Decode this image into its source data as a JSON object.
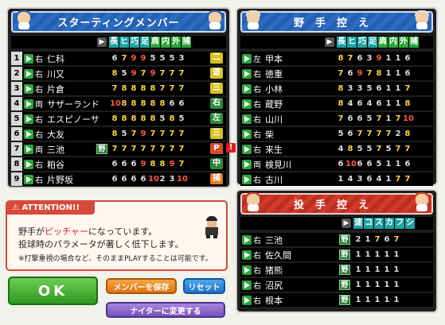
{
  "starting": {
    "title": "スターティングメンバー",
    "columns": [
      "長",
      "ヒ",
      "巧",
      "足",
      "肩",
      "内",
      "外",
      "捕"
    ],
    "rows": [
      {
        "num": "1",
        "hand": "右",
        "name": "仁科",
        "stats": [
          "6",
          "7",
          "9",
          "9",
          "5",
          "5",
          "5",
          "3"
        ],
        "pos": "二",
        "poscolor": "#d7c21b"
      },
      {
        "num": "2",
        "hand": "右",
        "name": "川又",
        "stats": [
          "8",
          "5",
          "9",
          "7",
          "9",
          "7",
          "7",
          "7"
        ],
        "pos": "遊",
        "poscolor": "#d7c21b"
      },
      {
        "num": "3",
        "hand": "右",
        "name": "片倉",
        "stats": [
          "7",
          "8",
          "8",
          "8",
          "8",
          "7",
          "7",
          "7"
        ],
        "pos": "三",
        "poscolor": "#d7c21b"
      },
      {
        "num": "4",
        "hand": "両",
        "name": "サザーランド",
        "stats": [
          "10",
          "8",
          "8",
          "8",
          "8",
          "8",
          "6",
          "6"
        ],
        "pos": "右",
        "poscolor": "#2b8b3a"
      },
      {
        "num": "5",
        "hand": "右",
        "name": "エスピノーサ",
        "stats": [
          "8",
          "8",
          "8",
          "8",
          "8",
          "5",
          "8",
          "5"
        ],
        "pos": "左",
        "poscolor": "#2b8b3a"
      },
      {
        "num": "6",
        "hand": "右",
        "name": "大友",
        "stats": [
          "8",
          "5",
          "7",
          "9",
          "7",
          "7",
          "7",
          "7"
        ],
        "pos": "三",
        "poscolor": "#d7c21b"
      },
      {
        "num": "7",
        "hand": "両",
        "name": "三池",
        "tag": "野",
        "stats": [
          "7",
          "7",
          "7",
          "7",
          "7",
          "7",
          "7",
          "7"
        ],
        "pos": "P",
        "poscolor": "#d64b2f"
      },
      {
        "num": "8",
        "hand": "右",
        "name": "粕谷",
        "stats": [
          "6",
          "6",
          "6",
          "9",
          "8",
          "8",
          "9",
          "7"
        ],
        "pos": "中",
        "poscolor": "#2b8b3a"
      },
      {
        "num": "9",
        "hand": "右",
        "name": "片野坂",
        "stats": [
          "6",
          "6",
          "6",
          "6",
          "10",
          "2",
          "3",
          "10"
        ],
        "pos": "捕",
        "poscolor": "#e07b22"
      }
    ]
  },
  "bench": {
    "title": "野手控え",
    "columns": [
      "長",
      "ヒ",
      "巧",
      "足",
      "肩",
      "内",
      "外",
      "捕"
    ],
    "rows": [
      {
        "hand": "左",
        "name": "甲本",
        "stats": [
          "8",
          "7",
          "6",
          "3",
          "9",
          "1",
          "1",
          "6"
        ]
      },
      {
        "hand": "右",
        "name": "徳重",
        "stats": [
          "7",
          "6",
          "9",
          "7",
          "8",
          "1",
          "1",
          "6"
        ]
      },
      {
        "hand": "右",
        "name": "小林",
        "stats": [
          "8",
          "3",
          "3",
          "5",
          "6",
          "1",
          "1",
          "7"
        ]
      },
      {
        "hand": "右",
        "name": "蔵野",
        "stats": [
          "8",
          "4",
          "6",
          "4",
          "6",
          "1",
          "1",
          "8"
        ]
      },
      {
        "hand": "右",
        "name": "山川",
        "stats": [
          "7",
          "6",
          "6",
          "5",
          "7",
          "1",
          "7",
          "10"
        ]
      },
      {
        "hand": "右",
        "name": "柴",
        "stats": [
          "5",
          "6",
          "7",
          "7",
          "7",
          "7",
          "2",
          "8"
        ]
      },
      {
        "hand": "右",
        "name": "来生",
        "stats": [
          "4",
          "8",
          "5",
          "5",
          "7",
          "5",
          "7",
          "7"
        ]
      },
      {
        "hand": "両",
        "name": "検見川",
        "stats": [
          "6",
          "10",
          "6",
          "6",
          "5",
          "1",
          "1",
          "6"
        ]
      },
      {
        "hand": "右",
        "name": "古川",
        "stats": [
          "1",
          "4",
          "3",
          "6",
          "4",
          "1",
          "7",
          "7"
        ]
      }
    ]
  },
  "pitchers": {
    "title": "投手控え",
    "columns": [
      "速",
      "コ",
      "ス",
      "カ",
      "フ",
      "シ"
    ],
    "rows": [
      {
        "hand": "右",
        "name": "三池",
        "stats": [
          "2",
          "1",
          "7",
          "6",
          "7"
        ]
      },
      {
        "hand": "右",
        "name": "佐久間",
        "stats": [
          "1",
          "1",
          "1",
          "1",
          "1"
        ]
      },
      {
        "hand": "右",
        "name": "猪熊",
        "stats": [
          "1",
          "1",
          "1",
          "1",
          "1"
        ]
      },
      {
        "hand": "右",
        "name": "沼尻",
        "stats": [
          "1",
          "1",
          "1",
          "1",
          "1"
        ]
      },
      {
        "hand": "右",
        "name": "根本",
        "stats": [
          "1",
          "1",
          "1",
          "1",
          "1"
        ]
      }
    ]
  },
  "attention": {
    "title": "ATTENTION!!",
    "line1_pre": "野手が",
    "line1_red": "ピッチャー",
    "line1_post": "になっています。",
    "line2": "投球時のパラメータが著しく低下します。",
    "line3": "※打撃重視の場合など、そのままPLAYすることは可能です。"
  },
  "buttons": {
    "ok": "OK",
    "save": "メンバーを保存",
    "reset": "リセット",
    "night": "ナイターに変更する"
  },
  "pitcher_tag": "野",
  "colors": {
    "accent_blue": "#2c6cc4",
    "accent_red": "#d23a2a",
    "stat_teal": "#1fa3a3",
    "ok_green": "#2f9a22"
  }
}
